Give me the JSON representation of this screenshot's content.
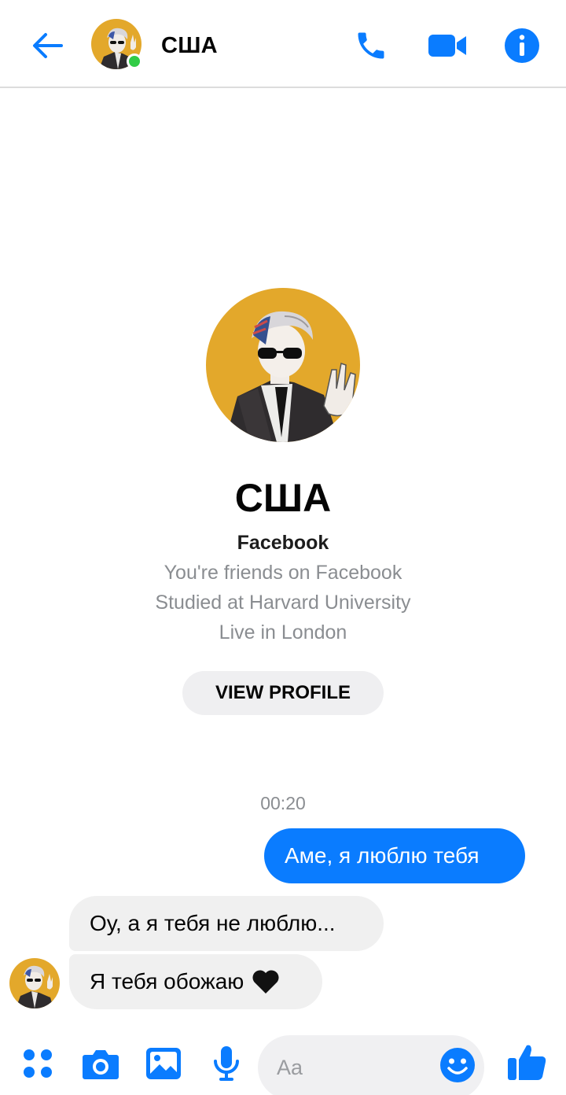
{
  "header": {
    "title": "США",
    "icons": {
      "back": "arrow-left-icon",
      "call": "phone-icon",
      "video": "video-camera-icon",
      "info": "info-icon"
    },
    "online": true
  },
  "profile": {
    "name": "США",
    "platform": "Facebook",
    "details": [
      "You're friends on Facebook",
      "Studied at Harvard University",
      "Live in London"
    ],
    "view_profile_label": "VIEW PROFILE"
  },
  "conversation": {
    "timestamp": "00:20",
    "outgoing": [
      {
        "text": "Аме, я люблю тебя"
      }
    ],
    "incoming": [
      {
        "text": "Оу, а я тебя не люблю..."
      },
      {
        "text": "Я тебя обожаю",
        "emoji": "black-heart-icon"
      }
    ]
  },
  "composer": {
    "placeholder": "Aa",
    "icons": [
      "apps-icon",
      "camera-icon",
      "image-icon",
      "microphone-icon",
      "emoji-icon",
      "thumbs-up-icon"
    ]
  },
  "colors": {
    "accent": "#0a7cff",
    "online": "#31cc46",
    "avatar_bg": "#e3a82b",
    "incoming_bubble": "#f0f0f0",
    "secondary_text": "#8a8d91"
  }
}
